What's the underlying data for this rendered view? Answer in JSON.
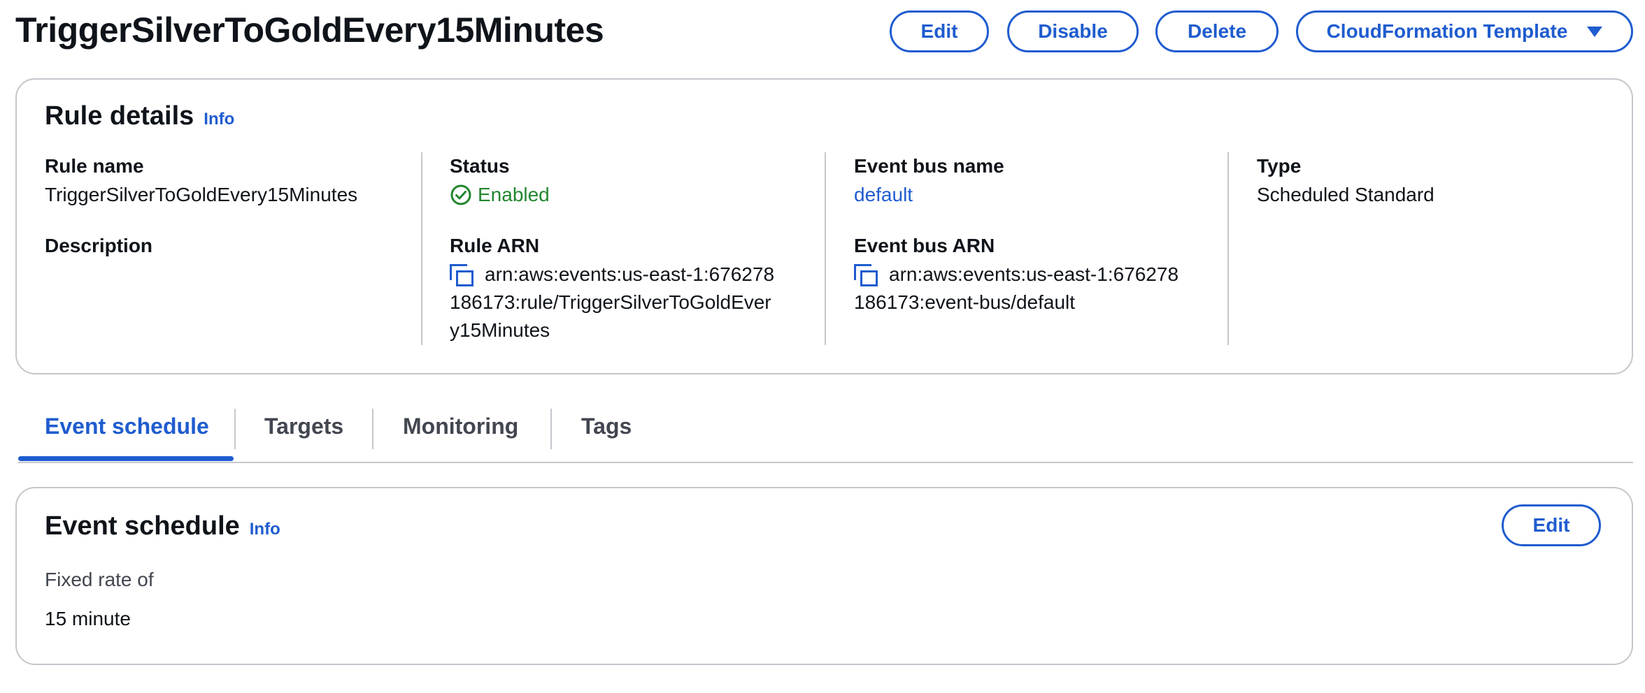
{
  "header": {
    "title": "TriggerSilverToGoldEvery15Minutes",
    "buttons": {
      "edit": "Edit",
      "disable": "Disable",
      "delete": "Delete",
      "cloudformation": "CloudFormation Template"
    }
  },
  "rule_details": {
    "heading": "Rule details",
    "info": "Info",
    "rule_name_label": "Rule name",
    "rule_name_value": "TriggerSilverToGoldEvery15Minutes",
    "description_label": "Description",
    "status_label": "Status",
    "status_value": "Enabled",
    "rule_arn_label": "Rule ARN",
    "rule_arn_lines": [
      "arn:aws:events:us-east-1:676278",
      "186173:rule/TriggerSilverToGoldEver",
      "y15Minutes"
    ],
    "event_bus_name_label": "Event bus name",
    "event_bus_name_value": "default",
    "event_bus_arn_label": "Event bus ARN",
    "event_bus_arn_lines": [
      "arn:aws:events:us-east-1:676278",
      "186173:event-bus/default"
    ],
    "type_label": "Type",
    "type_value": "Scheduled Standard"
  },
  "tabs": [
    "Event schedule",
    "Targets",
    "Monitoring",
    "Tags"
  ],
  "event_schedule": {
    "heading": "Event schedule",
    "info": "Info",
    "edit": "Edit",
    "rate_label": "Fixed rate of",
    "rate_value": "15 minute"
  },
  "colors": {
    "accent": "#1f5ccf",
    "status_ok": "#23862f",
    "border": "#c6c6cd"
  }
}
